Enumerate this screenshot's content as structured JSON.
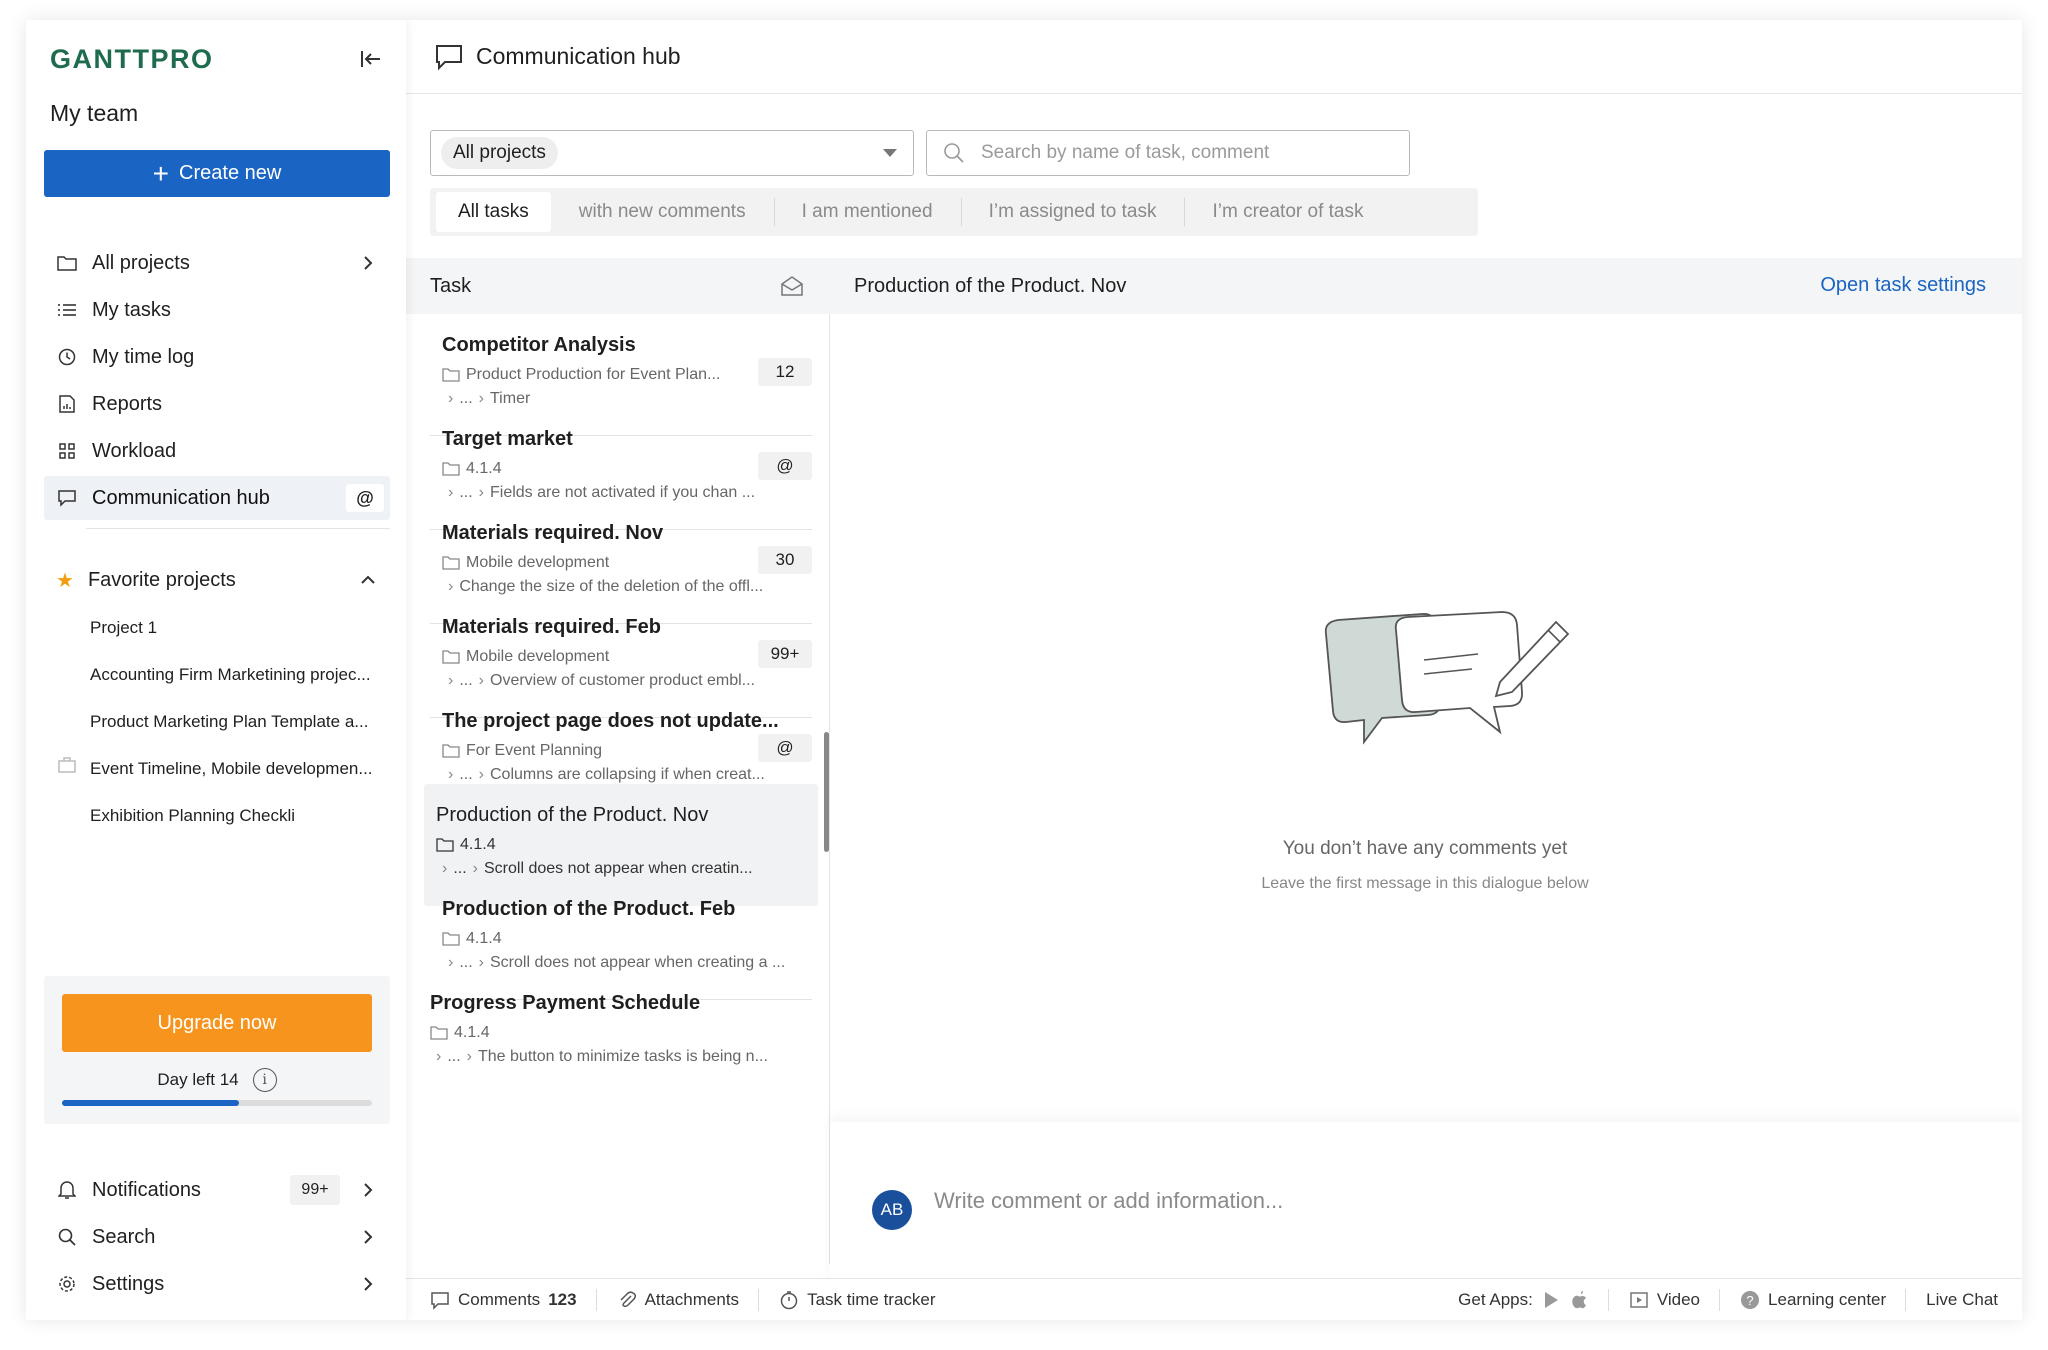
{
  "app": {
    "logo": "GANTTPRO",
    "team": "My team"
  },
  "sidebar": {
    "create_label": "Create new",
    "nav": [
      {
        "label": "All projects"
      },
      {
        "label": "My tasks"
      },
      {
        "label": "My time log"
      },
      {
        "label": "Reports"
      },
      {
        "label": "Workload"
      },
      {
        "label": "Communication hub",
        "badge": "@"
      }
    ],
    "favorites_label": "Favorite projects",
    "favorites": [
      "Project 1",
      "Accounting Firm Marketining projec...",
      "Product Marketing Plan Template a...",
      "Event Timeline, Mobile developmen...",
      "Exhibition Planning Checkli"
    ],
    "upgrade_label": "Upgrade now",
    "day_left": "Day left 14",
    "trial_progress": 0.57,
    "bottom": [
      {
        "label": "Notifications",
        "badge": "99+"
      },
      {
        "label": "Search"
      },
      {
        "label": "Settings"
      }
    ]
  },
  "header": {
    "title": "Communication hub"
  },
  "filters": {
    "project_select": "All projects",
    "search_placeholder": "Search by name of task, comment",
    "tabs": [
      "All tasks",
      "with new comments",
      "I am mentioned",
      "I’m assigned to task",
      "I’m creator of task"
    ]
  },
  "list": {
    "header": "Task",
    "items": [
      {
        "title": "Competitor Analysis",
        "project": "Product Production for Event Plan...",
        "crumb_mid": "...",
        "crumb": "Timer",
        "badge": "12"
      },
      {
        "title": "Target market",
        "project": "4.1.4",
        "crumb_mid": "...",
        "crumb": "Fields are not activated if you chan ...",
        "badge": "@"
      },
      {
        "title": "Materials required. Nov",
        "project": "Mobile development",
        "crumb_mid": "",
        "crumb": "Change the size of the deletion of the offl...",
        "badge": "30"
      },
      {
        "title": "Materials required. Feb",
        "project": "Mobile development",
        "crumb_mid": "...",
        "crumb": "Overview of customer product embl...",
        "badge": "99+"
      },
      {
        "title": "The project page does not update...",
        "project": "For Event Planning",
        "crumb_mid": "...",
        "crumb": "Columns are collapsing if when creat...",
        "badge": "@"
      },
      {
        "title": "Production of the Product. Nov",
        "project": "4.1.4",
        "crumb_mid": "...",
        "crumb": "Scroll does not appear when creatin...",
        "badge": ""
      },
      {
        "title": "Production of the Product. Feb",
        "project": "4.1.4",
        "crumb_mid": "...",
        "crumb": "Scroll does not appear when creating a ...",
        "badge": ""
      },
      {
        "title": "Progress Payment Schedule",
        "project": "4.1.4",
        "crumb_mid": "...",
        "crumb": "The button to minimize tasks is being n...",
        "badge": ""
      }
    ]
  },
  "detail": {
    "title": "Production of the Product. Nov",
    "settings_link": "Open task settings",
    "empty_title": "You don’t have any comments yet",
    "empty_sub": "Leave the first message in this dialogue below",
    "avatar": "AB",
    "comment_placeholder": "Write comment or add information..."
  },
  "footer": {
    "comments_label": "Comments",
    "comments_count": "123",
    "attachments": "Attachments",
    "tracker": "Task time tracker",
    "get_apps": "Get Apps:",
    "video": "Video",
    "learning": "Learning center",
    "chat": "Live Chat"
  },
  "colors": {
    "brand": "#1e6b4e",
    "primary": "#1a64c4",
    "upgrade": "#f7941d",
    "favorite": "#f39c12"
  }
}
